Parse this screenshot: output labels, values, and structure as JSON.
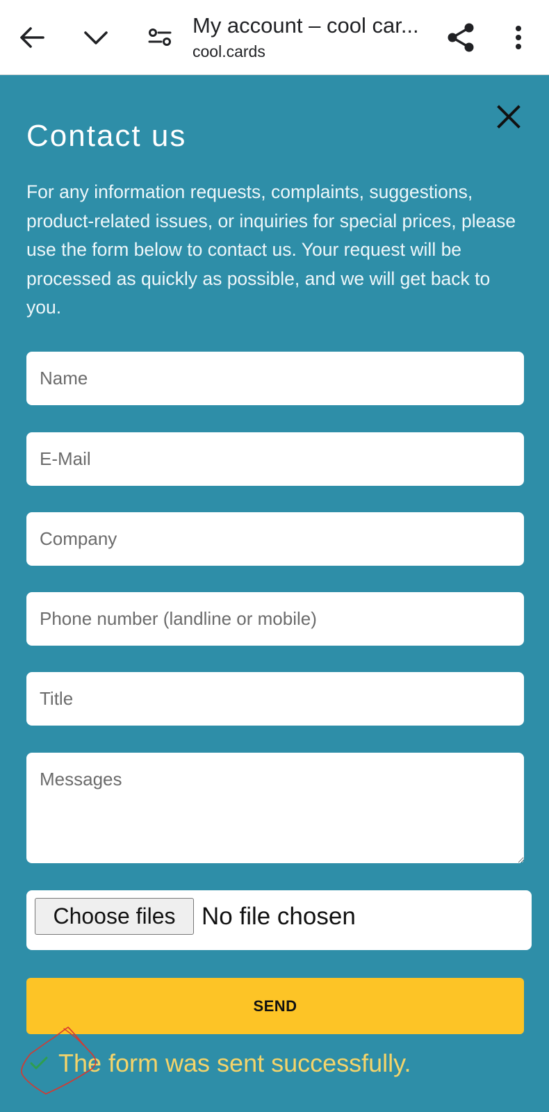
{
  "browser": {
    "title": "My account – cool car...",
    "url": "cool.cards",
    "icons": {
      "back": "arrow-left-icon",
      "collapse": "chevron-down-icon",
      "site_settings": "tune-icon",
      "share": "share-icon",
      "menu": "more-vert-icon"
    }
  },
  "modal": {
    "close_icon": "close-icon",
    "heading": "Contact us",
    "intro": "For any information requests, complaints, suggestions, product-related issues, or inquiries for special prices, please use the form below to contact us. Your request will be processed as quickly as possible, and we will get back to you."
  },
  "form": {
    "name_placeholder": "Name",
    "email_placeholder": "E-Mail",
    "company_placeholder": "Company",
    "phone_placeholder": "Phone number (landline or mobile)",
    "title_placeholder": "Title",
    "messages_placeholder": "Messages",
    "file_button": "Choose files",
    "file_status": "No file chosen",
    "send_label": "SEND"
  },
  "status": {
    "success_message": "The form was sent successfully.",
    "check_icon": "check-icon",
    "colors": {
      "background": "#2e8ea8",
      "send_button": "#fdc426",
      "success_text": "#f4d46a",
      "check": "#2e9e4f",
      "annotation": "#d9372e"
    }
  }
}
